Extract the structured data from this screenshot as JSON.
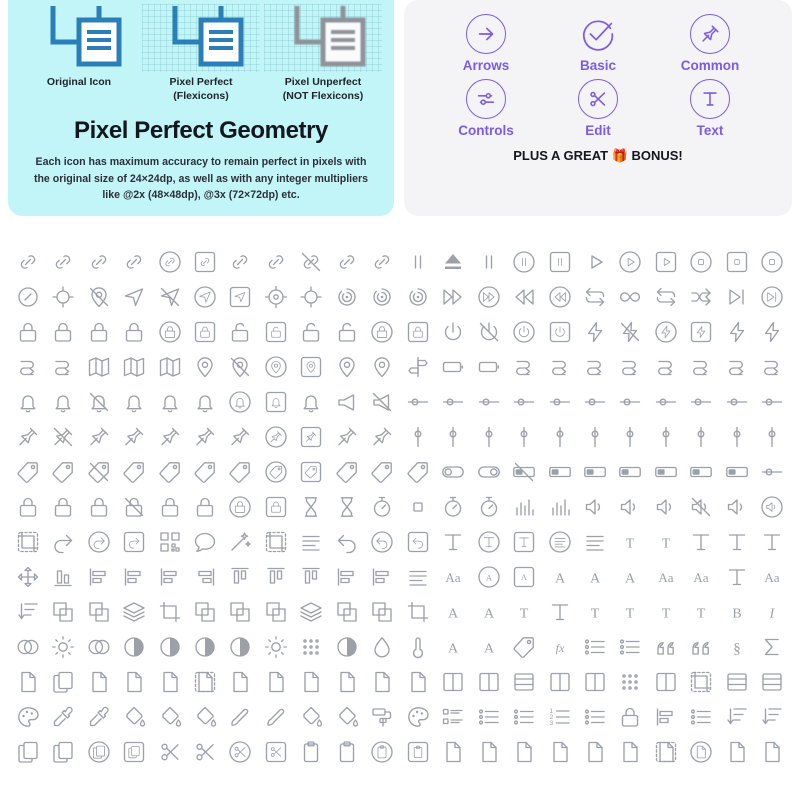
{
  "left_card": {
    "background_color": "#c2f5f7",
    "demos": [
      {
        "label": "Original Icon",
        "sublabel": "",
        "style": "crisp",
        "color": "#2b7fb8",
        "grid": false
      },
      {
        "label": "Pixel Perfect",
        "sublabel": "(Flexicons)",
        "style": "crisp",
        "color": "#2b7fb8",
        "grid": true
      },
      {
        "label": "Pixel Unperfect",
        "sublabel": "(NOT Flexicons)",
        "style": "blurred",
        "color": "#8d9399",
        "grid": true
      }
    ],
    "title": "Pixel Perfect Geometry",
    "body": "Each icon has maximum accuracy to remain perfect in pixels with the original size of 24×24dp, as well as with any integer multipliers like @2x (48×48dp), @3x (72×72dp) etc."
  },
  "right_card": {
    "background_color": "#f4f4f7",
    "accent_color": "#7c5ce0",
    "categories": [
      {
        "label": "Arrows",
        "icon": "arrow-right-circle-icon"
      },
      {
        "label": "Basic",
        "icon": "check-circle-icon"
      },
      {
        "label": "Common",
        "icon": "pushpin-circle-icon"
      },
      {
        "label": "Controls",
        "icon": "sliders-circle-icon"
      },
      {
        "label": "Edit",
        "icon": "scissors-circle-icon"
      },
      {
        "label": "Text",
        "icon": "text-t-circle-icon"
      }
    ],
    "bonus_text_before": "PLUS A GREAT ",
    "bonus_emoji": "🎁",
    "bonus_text_after": " BONUS!"
  },
  "icon_grid": {
    "columns": 22,
    "stroke_color": "#9ca0a8",
    "rows": [
      {
        "group": "links",
        "icons": [
          "link",
          "link-broken",
          "link-chain",
          "link-tilted",
          "link-circle",
          "link-square",
          "link-rounded",
          "link-filled",
          "link-slash",
          "link-sparkle",
          "link-burst",
          "pause-split",
          "eject",
          "pause",
          "pause-circle",
          "pause-square",
          "play",
          "play-circle",
          "play-square",
          "stop-circle-outline",
          "stop-square",
          "stop-square-circle"
        ]
      },
      {
        "group": "navigation",
        "icons": [
          "compass",
          "crosshair",
          "location-off",
          "navigation",
          "navigation-off",
          "navigation-circle",
          "navigation-square",
          "target",
          "target-crosshair",
          "radar",
          "radar-waves",
          "radar-rings",
          "fast-forward",
          "fast-forward-circle",
          "rewind",
          "rewind-circle",
          "repeat",
          "infinity",
          "repeat-one",
          "shuffle",
          "skip-next",
          "skip-next-circle"
        ]
      },
      {
        "group": "locks-power",
        "icons": [
          "lock-open-shackle",
          "lock",
          "lock-keyhole",
          "lock-round",
          "lock-circle",
          "lock-square",
          "unlock",
          "unlock-square",
          "unlock-keyhole",
          "unlock-round",
          "lock-shield-circle",
          "lock-shield-square",
          "power",
          "power-off",
          "power-circle",
          "power-square",
          "bolt",
          "bolt-off",
          "bolt-circle",
          "bolt-square",
          "bolt-refresh",
          "bolt-thin"
        ]
      },
      {
        "group": "maps-pins",
        "icons": [
          "route-a-b",
          "route-pins",
          "map",
          "map-folded",
          "map-pin-location",
          "pin",
          "pin-off",
          "pin-circle",
          "pin-square",
          "pin-base",
          "pin-person",
          "signpost",
          "battery-low",
          "battery-half",
          "route-cross",
          "route-line",
          "route-curve",
          "route-flag",
          "route-arrow",
          "route-node",
          "route-multi",
          "route-split"
        ]
      },
      {
        "group": "bells-sliders",
        "icons": [
          "bell",
          "bell-ring",
          "bell-off",
          "bell-small",
          "bell-tilt",
          "bell-shake",
          "bell-circle",
          "bell-square",
          "bell-badge",
          "megaphone",
          "megaphone-off",
          "slider-h",
          "slider-minus",
          "slider-dual",
          "slider-triple",
          "slider-multi",
          "slider-four",
          "slider-group",
          "slider-dense",
          "slider-wide",
          "slider-toggle",
          "slider-row"
        ]
      },
      {
        "group": "pushpins-sliders-v",
        "icons": [
          "pushpin",
          "pushpin-off",
          "pushpin-left",
          "pushpin-small",
          "pin-needle",
          "pin-needle-tilt",
          "pin-needle-thin",
          "pushpin-circle",
          "pushpin-square",
          "pushpin-filled",
          "pushpin-straight",
          "slider-v",
          "slider-v-two",
          "slider-v-three",
          "slider-v-four",
          "slider-v-group",
          "slider-v-dense",
          "slider-v-wide",
          "slider-v-multi",
          "slider-v-row",
          "slider-v-up",
          "slider-v-dual"
        ]
      },
      {
        "group": "tags-toggles",
        "icons": [
          "tag",
          "tag-double",
          "tag-off",
          "tag-plus",
          "tag-stack",
          "tag-small",
          "tag-wide",
          "tag-circle",
          "tag-square",
          "tag-vertical",
          "tag-tilt",
          "tag-hand",
          "toggle-left",
          "toggle-right",
          "switch-off",
          "switch-on",
          "switch-knob-left",
          "switch-knob-right",
          "switch-dot",
          "switch-dual",
          "switch-stack",
          "switch-slider"
        ]
      },
      {
        "group": "clocks-volume",
        "icons": [
          "clock",
          "alarm-clock",
          "clock-thin",
          "clock-off",
          "clock-hand",
          "clock-dotted",
          "clock-circle",
          "clock-square",
          "hourglass",
          "hourglass-half",
          "timer-arc",
          "stopwatch",
          "timer-rays",
          "timer-rays-alt",
          "bar-chart",
          "equalizer",
          "volume",
          "volume-high",
          "volume-minus",
          "volume-mute",
          "volume-plus",
          "volume-circle"
        ]
      },
      {
        "group": "edit-text",
        "icons": [
          "selection-dashed",
          "redo",
          "redo-circle",
          "redo-square",
          "qr-code",
          "speech-bubble",
          "magic-wand",
          "delete-dashed",
          "text-lines",
          "undo",
          "undo-circle",
          "undo-square",
          "text-t",
          "text-t-circle",
          "text-t-square",
          "text-align-circle",
          "text-document",
          "text-serif",
          "text-heading",
          "text-box",
          "text-cursor",
          "text-info"
        ]
      },
      {
        "group": "align-typography",
        "icons": [
          "move-all",
          "align-bottom",
          "align-center-v",
          "align-center-h",
          "align-left",
          "align-right",
          "align-top",
          "distribute-h",
          "distribute-v",
          "align-middle",
          "align-vertical",
          "text-justify",
          "text-aa",
          "text-a-circle",
          "text-a-square",
          "text-a-sup",
          "text-a-down",
          "text-a-up",
          "text-size",
          "text-kern",
          "text-tracking",
          "text-ligature"
        ]
      },
      {
        "group": "shapes-type",
        "icons": [
          "sort-arrows",
          "shape-overlap",
          "shape-copy",
          "shape-layers",
          "shape-transform",
          "shape-union",
          "shape-subtract",
          "shape-exclude",
          "layers-stack",
          "shape-front",
          "shape-behind",
          "transform-box",
          "text-a-reg",
          "text-underline",
          "text-lowercase",
          "text-titlecase",
          "text-smallcaps",
          "text-uppercase",
          "text-subscript",
          "text-superscript",
          "text-bold",
          "text-italic"
        ]
      },
      {
        "group": "color-lists",
        "icons": [
          "venn",
          "brightness-sun",
          "color-circles",
          "exposure",
          "contrast",
          "contrast-half",
          "color-wheel",
          "brightness",
          "particles",
          "tone",
          "droplet-fill",
          "thermometer",
          "paint-a",
          "text-a-outline",
          "code-tags",
          "function-fx",
          "list-detail",
          "list-plus",
          "quote",
          "quote-ratio",
          "section",
          "sum"
        ]
      },
      {
        "group": "files-columns",
        "icons": [
          "file",
          "files-copy",
          "file-download",
          "file-corner",
          "file-stack",
          "file-dashed",
          "file-fold",
          "file-page",
          "file-blank",
          "file-dash-fold",
          "file-split",
          "file-edge",
          "columns-two",
          "columns-pair",
          "table-rows",
          "columns-three",
          "columns-bars",
          "grid-dots",
          "columns-multi",
          "crop-dashed",
          "layout-split",
          "layout-list"
        ]
      },
      {
        "group": "paint-lists",
        "icons": [
          "swatches",
          "eyedropper",
          "eyedropper-alt",
          "fill-drop",
          "fill-pour",
          "paint-bucket-tilt",
          "paint-brush-wide",
          "paint-brush",
          "bucket",
          "bucket-round",
          "paint-roller",
          "palette",
          "list-checkbox",
          "list-bullet",
          "list-dot",
          "list-number",
          "list-star",
          "list-blocks",
          "list-align",
          "list-lines",
          "sort-asc",
          "sort-desc"
        ]
      },
      {
        "group": "copy-cut",
        "icons": [
          "copy",
          "copy-pages",
          "copy-circle",
          "copy-square",
          "scissors",
          "scissors-alt",
          "scissors-circle",
          "scissors-square",
          "clipboard-copy",
          "clipboard",
          "clipboard-circle",
          "clipboard-square",
          "page-plus",
          "page-minus",
          "page-book",
          "page-flag",
          "page-arrows",
          "page-insert",
          "page-dashed",
          "page-circle",
          "page-resize",
          "page-bracket"
        ]
      }
    ]
  }
}
